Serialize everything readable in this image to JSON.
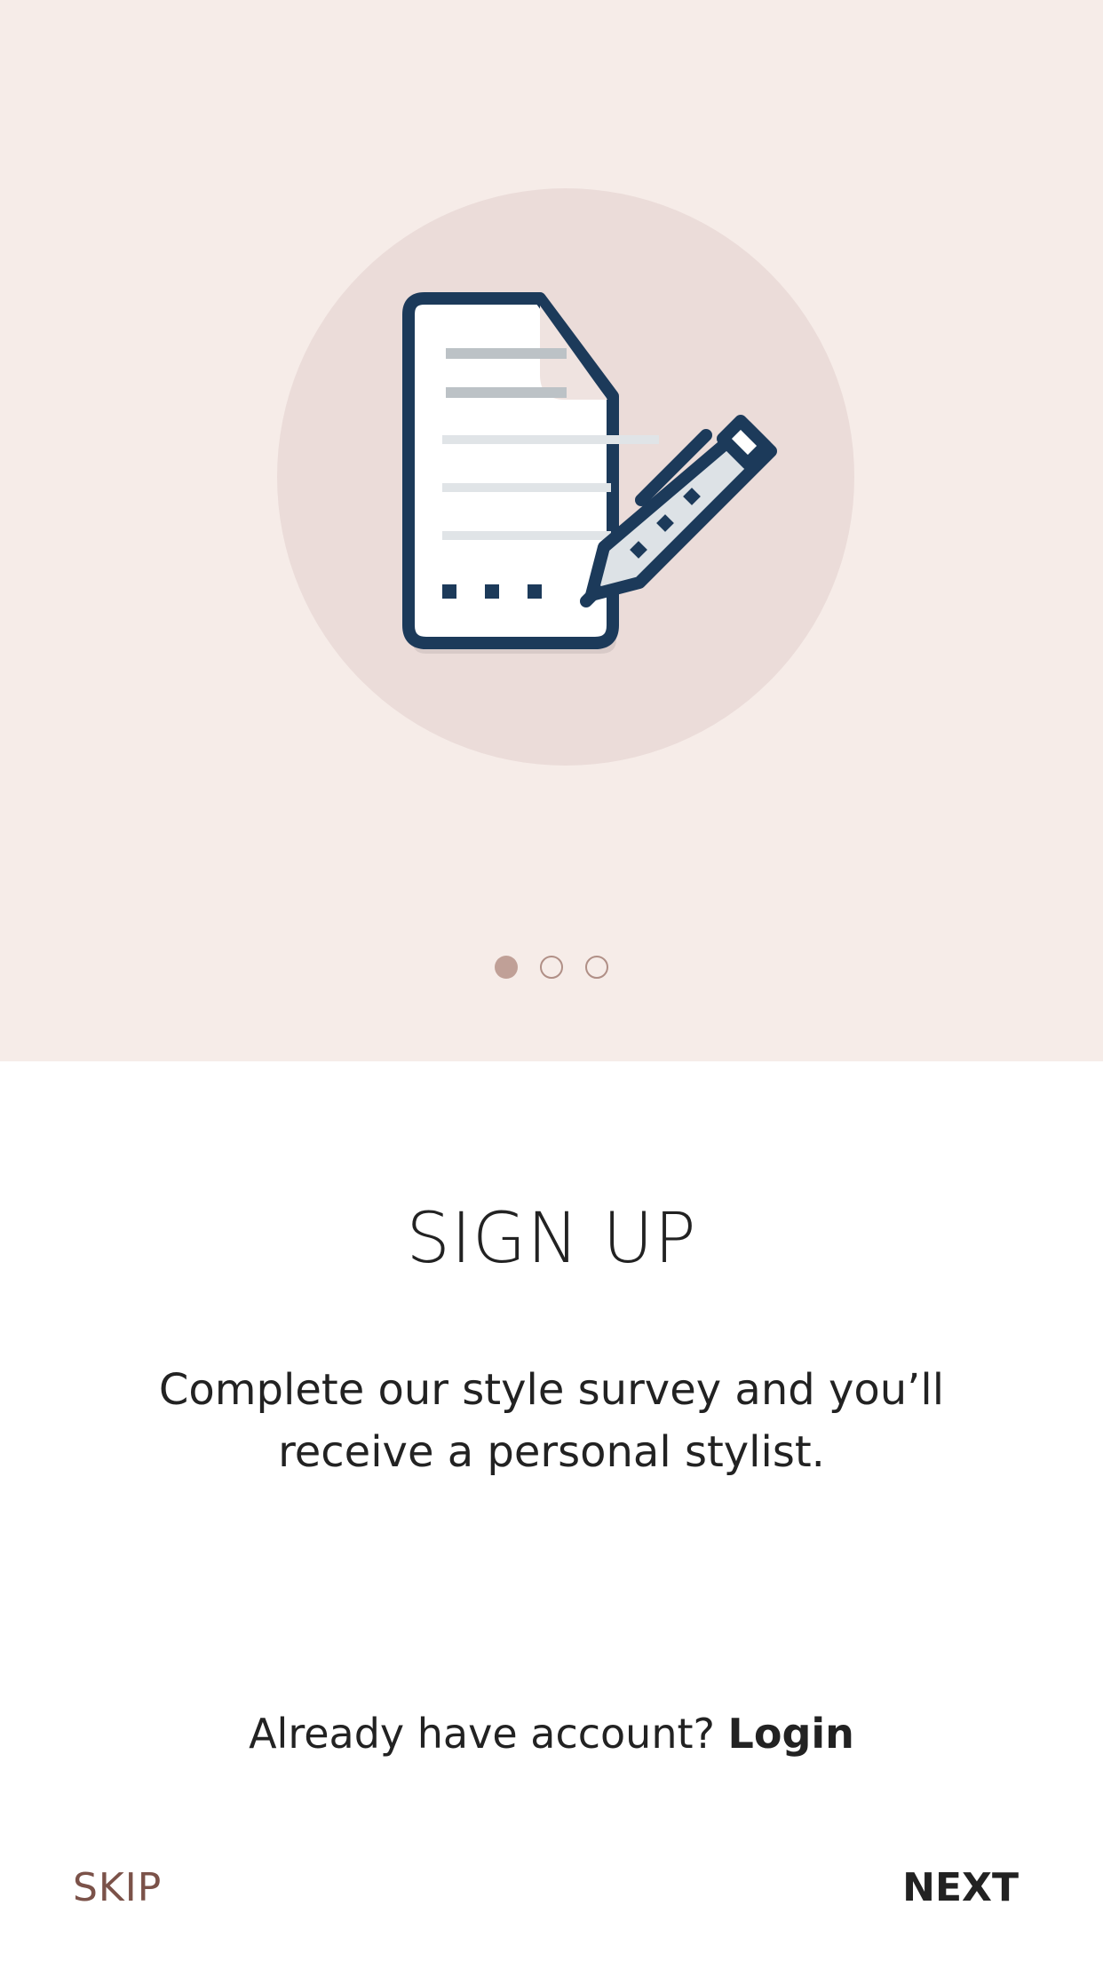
{
  "onboarding": {
    "illustration_icon": "document-with-pen-icon",
    "page_indicator": {
      "total": 3,
      "active_index": 0
    },
    "title": "SIGN UP",
    "description": "Complete our style survey and you’ll receive a personal stylist.",
    "login_prompt": "Already have account?",
    "login_label": "Login",
    "skip_label": "SKIP",
    "next_label": "NEXT"
  },
  "colors": {
    "hero_background": "#f6ece8",
    "circle_background": "#ebdcd9",
    "icon_stroke": "#1c3a5a",
    "dot_active": "#c0a097",
    "skip_text": "#7b5249"
  }
}
